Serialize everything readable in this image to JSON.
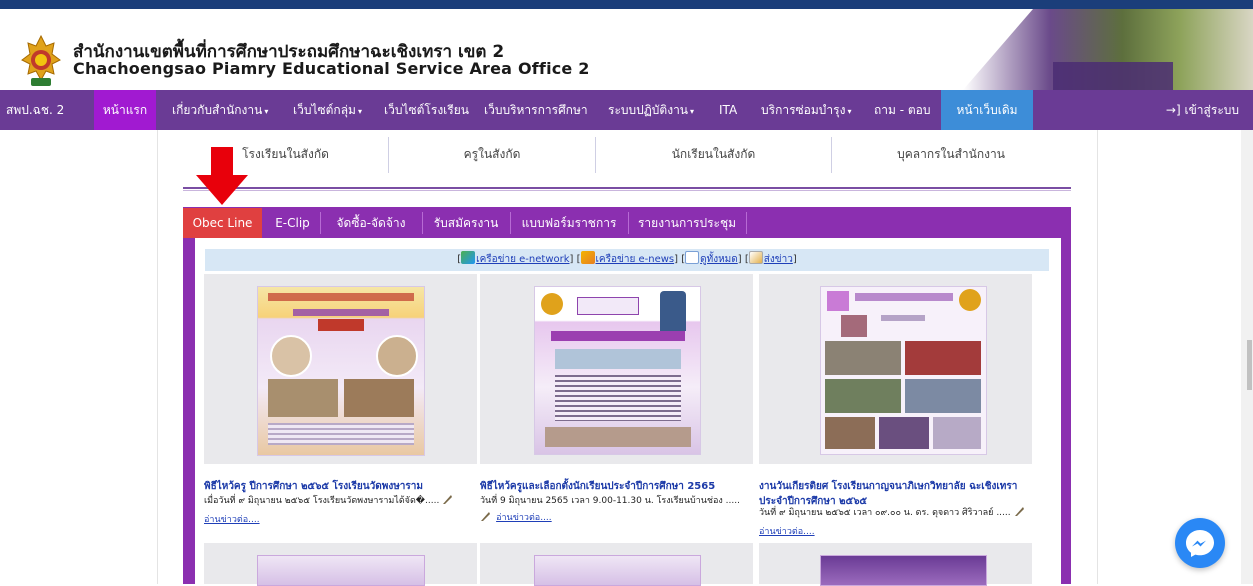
{
  "header": {
    "title_th": "สำนักงานเขตพื้นที่การศึกษาประถมศึกษาฉะเชิงเทรา เขต 2",
    "title_en": "Chachoengsao Piamry Educational Service Area Office 2"
  },
  "nav": {
    "items": [
      {
        "label": "สพป.ฉช. 2",
        "dropdown": false
      },
      {
        "label": "หน้าแรก",
        "dropdown": false,
        "active": true
      },
      {
        "label": "เกี่ยวกับสำนักงาน",
        "dropdown": true
      },
      {
        "label": "เว็บไซต์กลุ่ม",
        "dropdown": true
      },
      {
        "label": "เว็บไซต์โรงเรียน",
        "dropdown": false
      },
      {
        "label": "เว็บบริหารการศึกษา",
        "dropdown": false
      },
      {
        "label": "ระบบปฏิบัติงาน",
        "dropdown": true
      },
      {
        "label": "ITA",
        "dropdown": false
      },
      {
        "label": "บริการซ่อมบำรุง",
        "dropdown": true
      },
      {
        "label": "ถาม - ตอบ",
        "dropdown": false
      },
      {
        "label": "หน้าเว็บเดิม",
        "dropdown": false,
        "highlight": true
      }
    ],
    "caret": "▾",
    "login_icon": "→]",
    "login_label": "เข้าสู่ระบบ"
  },
  "subtabs": [
    "โรงเรียนในสังกัด",
    "ครูในสังกัด",
    "นักเรียนในสังกัด",
    "บุคลากรในสำนักงาน"
  ],
  "panel_tabs": [
    "Obec Line",
    "E-Clip",
    "จัดซื้อ-จัดจ้าง",
    "รับสมัครงาน",
    "แบบฟอร์มราชการ",
    "รายงานการประชุม"
  ],
  "linkbar": {
    "network": "เครือข่าย e-network",
    "news": "เครือข่าย e-news",
    "all": "ดูทั้งหมด",
    "send": "ส่งข่าว",
    "open": "[",
    "close": "]",
    "between": "] ["
  },
  "cards": [
    {
      "title": "พิธีไหว้ครู ปีการศึกษา ๒๕๖๕ โรงเรียนวัดพงษาราม",
      "desc": "เมื่อวันที่ ๙ มิถุนายน ๒๕๖๕ โรงเรียนวัดพงษารามได้จัด�.....",
      "readmore": "อ่านข่าวต่อ...."
    },
    {
      "title": "พิธีไหว้ครูและเลือกตั้งนักเรียนประจำปีการศึกษา 2565",
      "desc": "วันที่ 9 มิถุนายน 2565 เวลา 9.00-11.30 น. โรงเรียนบ้านช่อง .....",
      "readmore": "อ่านข่าวต่อ...."
    },
    {
      "title": "งานวันเกียรติยศ โรงเรียนกาญจนาภิเษกวิทยาลัย ฉะเชิงเทรา",
      "title2": "ประจำปีการศึกษา ๒๕๖๕",
      "desc": "วันที่ ๙ มิถุนายน ๒๕๖๕ เวลา ๐๙.๐๐ น. ดร. ดุจดาว ศิริวาลย์ .....",
      "readmore": "อ่านข่าวต่อ...."
    }
  ],
  "colors": {
    "nav_bg": "#6a3b95",
    "nav_active": "#a11ad1",
    "nav_highlight": "#3d8dd8",
    "panel_bg": "#8b2fb0",
    "tab_active": "#e04040",
    "arrow": "#e8000b"
  }
}
